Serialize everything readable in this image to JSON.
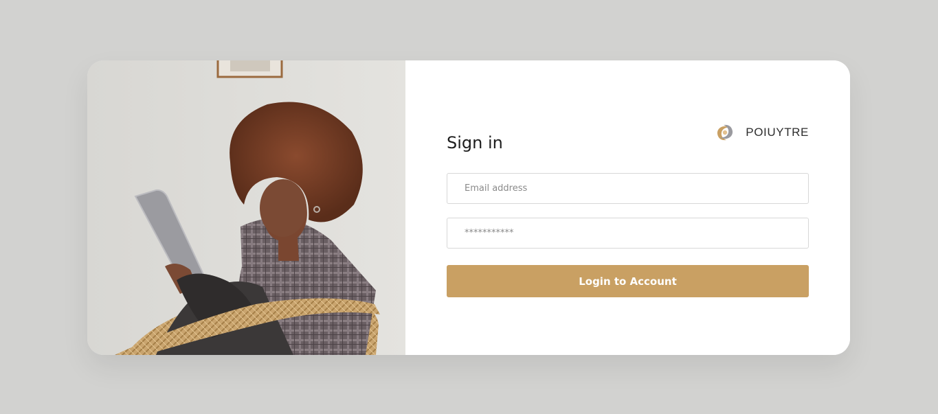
{
  "brand": {
    "name": "POIUYTRE",
    "logo_icon": "swirl-logo-icon"
  },
  "form": {
    "title": "Sign in",
    "email_placeholder": "Email address",
    "password_placeholder": "***********",
    "submit_label": "Login to Account"
  },
  "photo": {
    "alt": "woman-reading-tablet-image"
  },
  "colors": {
    "page_background": "#d2d2d0",
    "card_background": "#ffffff",
    "accent": "#c9a063",
    "border": "#d7d7d7",
    "text": "#1d1d1d"
  }
}
